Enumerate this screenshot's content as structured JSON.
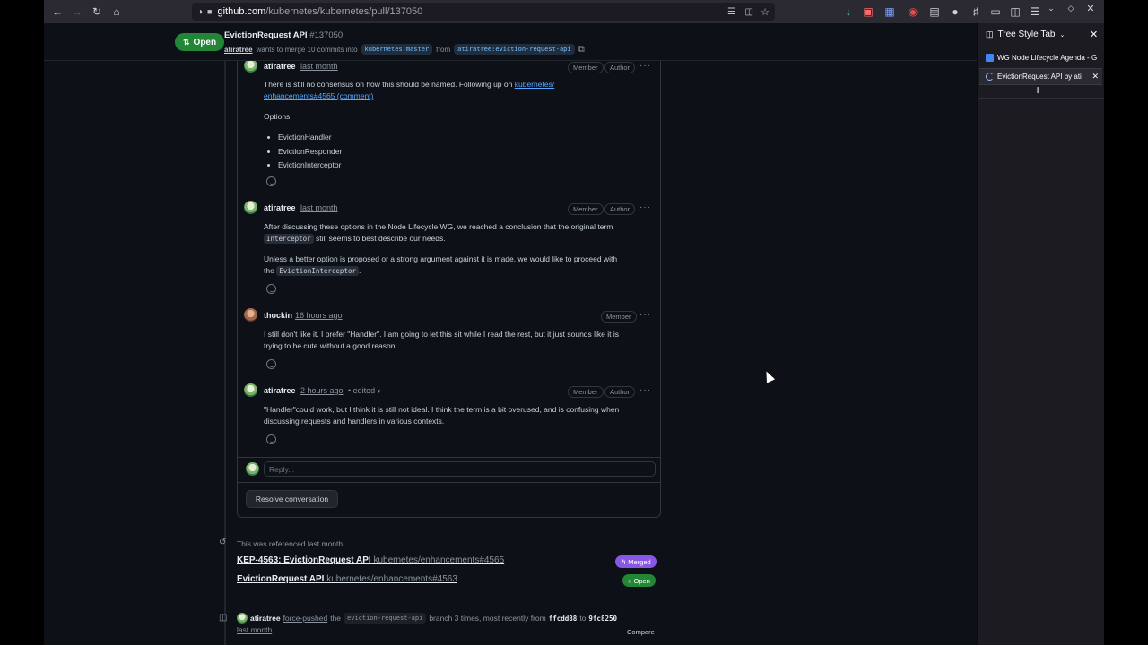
{
  "browser": {
    "url_host": "github.com",
    "url_path": "/kubernetes/kubernetes/pull/137050"
  },
  "pr_header": {
    "state_label": "Open",
    "title": "EvictionRequest API",
    "number": "#137050",
    "author": "atiratree",
    "merge_text": "wants to merge 10 commits into",
    "base_branch": "kubernetes:master",
    "from_text": "from",
    "head_branch": "atiratree:eviction-request-api"
  },
  "comments": [
    {
      "author": "atiratree",
      "time": "last month",
      "labels": [
        "Member",
        "Author"
      ],
      "paragraph1": "There is still no consensus on how this should be named. Following up on",
      "link_text_line1": "kubernetes/",
      "link_text_line2": "enhancements#4565 (comment)",
      "options_heading": "Options:",
      "options": [
        "EvictionHandler",
        "EvictionResponder",
        "EvictionInterceptor"
      ]
    },
    {
      "author": "atiratree",
      "time": "last month",
      "labels": [
        "Member",
        "Author"
      ],
      "line1": "After discussing these options in the Node Lifecycle WG, we reached a conclusion that the original term",
      "code1": "Interceptor",
      "line1b": "still seems to best describe our needs.",
      "line2": "Unless a better option is proposed or a strong argument against it is made, we would like to proceed with",
      "line2b_prefix": "the",
      "code2": "EvictionInterceptor",
      "line2b_suffix": "."
    },
    {
      "author": "thockin",
      "time": "16 hours ago",
      "labels": [
        "Member"
      ],
      "text_line1": "I still don't like it. I prefer \"Handler\". I am going to let this sit while I read the rest, but it just sounds like it is",
      "text_line2": "trying to be cute without a good reason"
    },
    {
      "author": "atiratree",
      "time": "2 hours ago",
      "edited": "• edited",
      "labels": [
        "Member",
        "Author"
      ],
      "text_line1": "\"Handler\"could work, but I think it is still not ideal. I think the term is a bit overused, and is confusing when",
      "text_line2": "discussing requests and handlers in various contexts."
    }
  ],
  "reply": {
    "placeholder": "Reply..."
  },
  "resolve_button": "Resolve conversation",
  "reference_event": {
    "text": "This was referenced last month",
    "items": [
      {
        "title": "KEP-4563: EvictionRequest API",
        "repo": "kubernetes/enhancements#4565",
        "badge": "Merged",
        "badge_color": "#8957e5"
      },
      {
        "title": "EvictionRequest API",
        "repo": "kubernetes/enhancements#4563",
        "badge": "Open",
        "badge_color": "#238636"
      }
    ]
  },
  "push_event": {
    "author": "atiratree",
    "action": "force-pushed",
    "the": "the",
    "branch": "eviction-request-api",
    "middle": "branch 3 times, most recently from",
    "from_sha": "ffcdd88",
    "to": "to",
    "to_sha": "9fc8250",
    "time": "last month",
    "compare": "Compare"
  },
  "sidebar": {
    "title": "Tree Style Tab",
    "tabs": [
      "WG Node Lifecycle Agenda - G",
      "EvictionRequest API by ati"
    ]
  }
}
